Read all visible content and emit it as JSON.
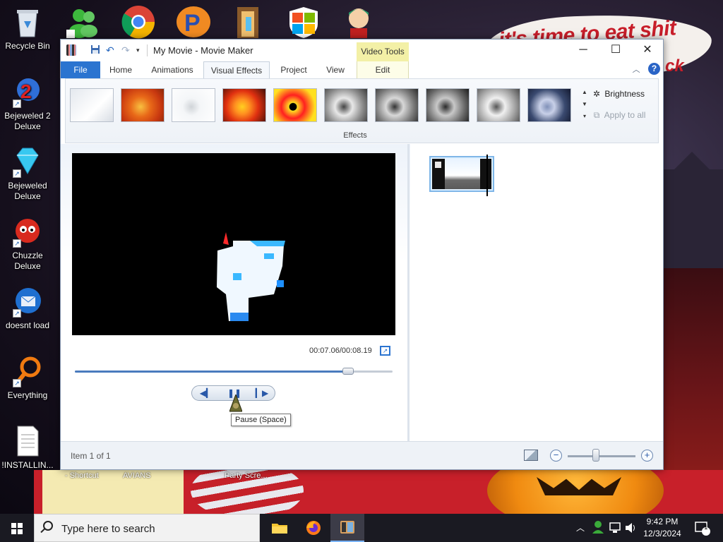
{
  "desktop": {
    "wall_text_1": "it's time to eat shit",
    "wall_text_2": "ck",
    "bg_shortcuts": [
      " - Shortcut",
      "AVIANS",
      "Party Scre..."
    ],
    "icons": [
      {
        "label": "Recycle Bin"
      },
      {
        "label": "Bejeweled 2 Deluxe"
      },
      {
        "label": "Bejeweled Deluxe"
      },
      {
        "label": "Chuzzle Deluxe"
      },
      {
        "label": "doesnt load"
      },
      {
        "label": "Everything"
      },
      {
        "label": "!INSTALLIN..."
      }
    ]
  },
  "window": {
    "title": "My Movie - Movie Maker",
    "context_tab_header": "Video Tools",
    "controls": {
      "minimize": "─",
      "maximize": "☐",
      "close": "✕"
    },
    "tabs": [
      "File",
      "Home",
      "Animations",
      "Visual Effects",
      "Project",
      "View",
      "Edit"
    ],
    "active_tab": "Visual Effects",
    "help": "?",
    "collapse": "︿"
  },
  "ribbon": {
    "effects_group_label": "Effects",
    "effects": [
      "No effect",
      "Warm",
      "Pale",
      "Orange glow",
      "Posterize",
      "Sepia",
      "Black and white",
      "Grayscale",
      "Bright gray",
      "Cyanotype"
    ],
    "gallery_scroll": [
      "▲",
      "▼",
      "▾"
    ],
    "brightness_label": "Brightness",
    "apply_all_label": "Apply to all"
  },
  "player": {
    "timecode": "00:07.06/00:08.19",
    "progress": 0.86,
    "buttons": {
      "previous": "◀▎",
      "pause": "❚❚",
      "next": "▎▶"
    },
    "tooltip": "Pause (Space)"
  },
  "status": {
    "item_text": "Item 1 of 1",
    "zoom_out": "−",
    "zoom_in": "+",
    "zoom_level": 0.42
  },
  "taskbar": {
    "search_placeholder": "Type here to search",
    "time": "9:42 PM",
    "date": "12/3/2024",
    "notification_count": "1",
    "tray_arrow": "︿"
  }
}
